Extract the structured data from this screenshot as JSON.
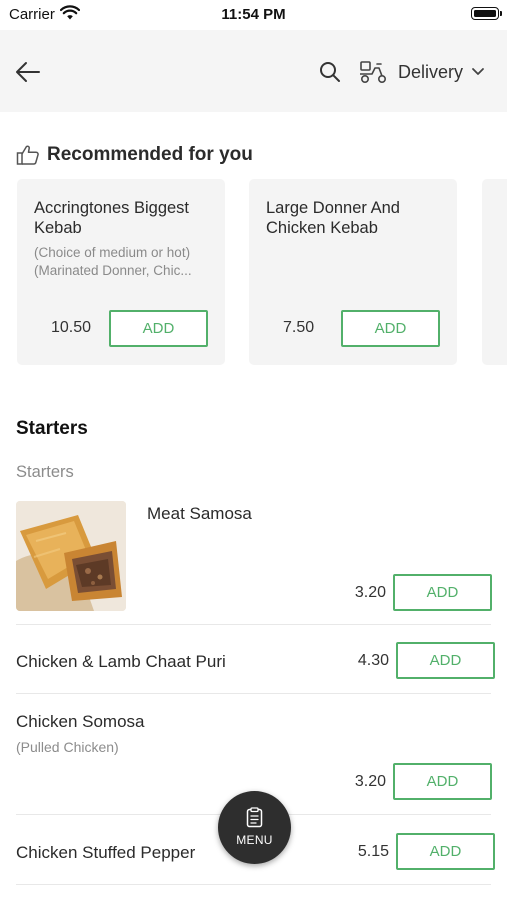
{
  "status_bar": {
    "carrier": "Carrier",
    "time": "11:54 PM"
  },
  "header": {
    "delivery_label": "Delivery"
  },
  "recommended": {
    "title": "Recommended for you",
    "cards": [
      {
        "name": "Accringtones Biggest Kebab",
        "description": "(Choice of medium or hot) (Marinated Donner, Chic...",
        "price": "10.50",
        "add_label": "ADD"
      },
      {
        "name": "Large Donner And Chicken Kebab",
        "description": "",
        "price": "7.50",
        "add_label": "ADD"
      }
    ]
  },
  "menu": {
    "section_title": "Starters",
    "subsection_title": "Starters",
    "items": [
      {
        "name": "Meat Samosa",
        "description": "",
        "price": "3.20",
        "add_label": "ADD",
        "has_image": true
      },
      {
        "name": "Chicken & Lamb Chaat Puri",
        "description": "",
        "price": "4.30",
        "add_label": "ADD"
      },
      {
        "name": "Chicken Somosa",
        "description": "(Pulled Chicken)",
        "price": "3.20",
        "add_label": "ADD"
      },
      {
        "name": "Chicken Stuffed Pepper",
        "description": "",
        "price": "5.15",
        "add_label": "ADD"
      }
    ]
  },
  "fab": {
    "label": "MENU",
    "icon": "menu-clipboard-icon"
  },
  "colors": {
    "accent": "#52b06a",
    "header_bg": "#f5f5f5",
    "card_bg": "#f4f4f4",
    "fab_bg": "#2e2e2e"
  },
  "icons": [
    "wifi-icon",
    "battery-icon",
    "back-arrow-icon",
    "search-icon",
    "scooter-icon",
    "chevron-down-icon",
    "thumbs-up-icon"
  ]
}
